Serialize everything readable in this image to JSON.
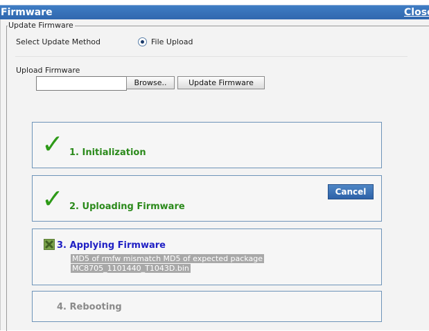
{
  "window": {
    "title": "Firmware",
    "close_label": "Close"
  },
  "form": {
    "legend": "Update Firmware",
    "method_label": "Select Update Method",
    "method_option": "File Upload",
    "upload_label": "Upload Firmware",
    "file_value": "",
    "browse_label": "Browse..",
    "update_label": "Update Firmware"
  },
  "steps": [
    {
      "label": "1. Initialization",
      "status": "done"
    },
    {
      "label": "2. Uploading Firmware",
      "status": "done",
      "cancel_label": "Cancel"
    },
    {
      "label": "3. Applying Firmware",
      "status": "error",
      "message_line1": "MD5 of rmfw mismatch MD5 of expected package",
      "message_line2": "MC8705_1101440_T1043D.bin"
    },
    {
      "label": "4. Rebooting",
      "status": "pending"
    }
  ],
  "icons": {
    "done": "checkmark-icon",
    "error": "error-x-icon"
  },
  "colors": {
    "titlebar": "#3a75bd",
    "done": "#2b8a1b",
    "active": "#1f1fc4",
    "pending": "#8a8a8a"
  }
}
